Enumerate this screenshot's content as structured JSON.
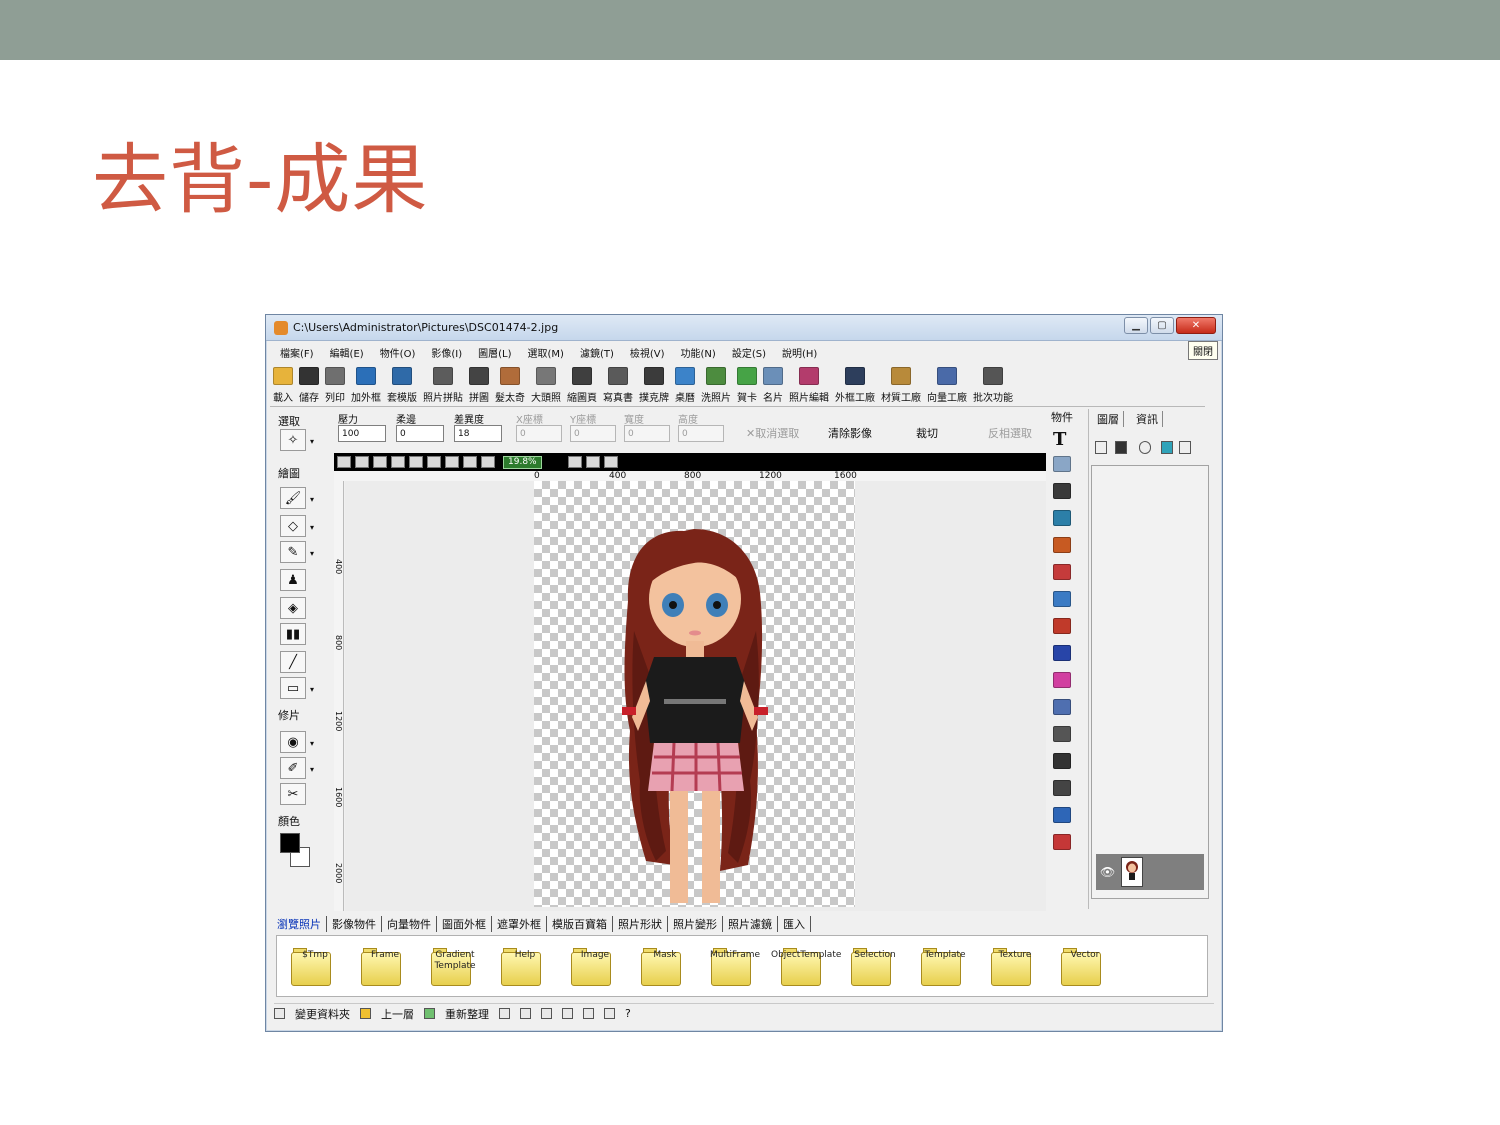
{
  "slide": {
    "title": "去背-成果",
    "colors": {
      "top_band": "#8f9e95",
      "title": "#cf5a43"
    }
  },
  "window": {
    "title": "C:\\Users\\Administrator\\Pictures\\DSC01474-2.jpg",
    "close_tooltip": "關閉",
    "buttons": {
      "minimize_icon": "minimize-icon",
      "maximize_icon": "maximize-icon",
      "close_icon": "close-icon"
    },
    "close_button_color": "#c62b19"
  },
  "menubar": [
    "檔案(F)",
    "編輯(E)",
    "物件(O)",
    "影像(I)",
    "圖層(L)",
    "選取(M)",
    "濾鏡(T)",
    "檢視(V)",
    "功能(N)",
    "設定(S)",
    "說明(H)"
  ],
  "toolbar": [
    {
      "label": "載入",
      "icon": "folder-open-icon",
      "color": "#e7b33b"
    },
    {
      "label": "儲存",
      "icon": "floppy-icon",
      "color": "#333333"
    },
    {
      "label": "列印",
      "icon": "printer-icon",
      "color": "#6f6f6f"
    },
    {
      "label": "加外框",
      "icon": "frame-icon",
      "color": "#2b6fb8"
    },
    {
      "label": "套模版",
      "icon": "template-icon",
      "color": "#2f6aa8"
    },
    {
      "label": "照片拼貼",
      "icon": "collage-icon",
      "color": "#5c5c5c"
    },
    {
      "label": "拼圖",
      "icon": "puzzle-icon",
      "color": "#444444"
    },
    {
      "label": "髮太奇",
      "icon": "hair-icon",
      "color": "#b06c3a"
    },
    {
      "label": "大頭照",
      "icon": "portrait-grid-icon",
      "color": "#777777"
    },
    {
      "label": "縮圖頁",
      "icon": "thumbnail-page-icon",
      "color": "#3f3f3f"
    },
    {
      "label": "寫真書",
      "icon": "photobook-icon",
      "color": "#5a5a5a"
    },
    {
      "label": "撲克牌",
      "icon": "poker-card-icon",
      "color": "#3b3b3b"
    },
    {
      "label": "桌曆",
      "icon": "desk-calendar-icon",
      "color": "#3c83c9"
    },
    {
      "label": "洗照片",
      "icon": "print-photo-icon",
      "color": "#4d8c3f"
    },
    {
      "label": "賀卡",
      "icon": "greeting-card-icon",
      "color": "#46a346"
    },
    {
      "label": "名片",
      "icon": "business-card-icon",
      "color": "#6b8fb8"
    },
    {
      "label": "照片編輯",
      "icon": "photo-edit-icon",
      "color": "#b33c6c"
    },
    {
      "label": "外框工廠",
      "icon": "frame-factory-icon",
      "color": "#2d3e5c"
    },
    {
      "label": "材質工廠",
      "icon": "texture-factory-icon",
      "color": "#b88a3a"
    },
    {
      "label": "向量工廠",
      "icon": "vector-factory-icon",
      "color": "#4a6aa8"
    },
    {
      "label": "批次功能",
      "icon": "batch-icon",
      "color": "#555555"
    }
  ],
  "left_panel": {
    "select_label": "選取",
    "draw_label": "繪圖",
    "retouch_label": "修片",
    "color_label": "顏色",
    "tools": [
      {
        "name": "magic-wand-icon",
        "glyph": "✧"
      },
      {
        "name": "brush-icon",
        "glyph": "🖌"
      },
      {
        "name": "eraser-icon",
        "glyph": "◇"
      },
      {
        "name": "pen-icon",
        "glyph": "✎"
      },
      {
        "name": "stamp-icon",
        "glyph": "♟"
      },
      {
        "name": "fill-bucket-icon",
        "glyph": "◈"
      },
      {
        "name": "gradient-icon",
        "glyph": "▮▮"
      },
      {
        "name": "eyedropper-icon",
        "glyph": "╱"
      },
      {
        "name": "rectangle-icon",
        "glyph": "▭"
      },
      {
        "name": "red-eye-icon",
        "glyph": "◉"
      },
      {
        "name": "heal-brush-icon",
        "glyph": "✐"
      },
      {
        "name": "clone-icon",
        "glyph": "✂"
      }
    ],
    "fg_color": "#000000",
    "bg_color": "#ffffff"
  },
  "options": {
    "pressure_label": "壓力",
    "softness_label": "柔邊",
    "tolerance_label": "差異度",
    "x_label": "X座標",
    "y_label": "Y座標",
    "width_label": "寬度",
    "height_label": "高度",
    "pressure_value": "100",
    "softness_value": "0",
    "tolerance_value": "18",
    "x_value": "0",
    "y_value": "0",
    "width_value": "0",
    "height_value": "0",
    "cancel_select": "✕取消選取",
    "clear_image": "清除影像",
    "crop": "裁切",
    "invert_select": "反相選取"
  },
  "canvas": {
    "zoom": "19.8%",
    "ruler_top": [
      "0",
      "400",
      "800",
      "1200",
      "1600"
    ],
    "ruler_left": [
      "400",
      "800",
      "1200",
      "1600",
      "2000"
    ]
  },
  "object_strip": {
    "label": "物件",
    "icons": [
      {
        "name": "text-icon",
        "color": "#000000"
      },
      {
        "name": "text-effect-icon",
        "color": "#8aa6c6"
      },
      {
        "name": "abc-stamp-icon",
        "color": "#3a3a3a"
      },
      {
        "name": "image-insert-icon",
        "color": "#2c7fa8"
      },
      {
        "name": "photo-insert-icon",
        "color": "#c75a22"
      },
      {
        "name": "layer-group-icon",
        "color": "#c53b3b"
      },
      {
        "name": "zoom-icon",
        "color": "#3b7bc4"
      },
      {
        "name": "clock-icon",
        "color": "#c03a2a"
      },
      {
        "name": "exif-icon",
        "color": "#2845a8"
      },
      {
        "name": "cake-icon",
        "color": "#d13fa0"
      },
      {
        "name": "calendar-icon",
        "color": "#4f6fb0"
      },
      {
        "name": "speech-bubble-icon",
        "color": "#555555"
      },
      {
        "name": "lines-icon",
        "color": "#333333"
      },
      {
        "name": "arrow-icon",
        "color": "#444444"
      },
      {
        "name": "star-shape-icon",
        "color": "#2e66b7"
      },
      {
        "name": "pattern-icon",
        "color": "#c53737"
      }
    ]
  },
  "layers_panel": {
    "tabs": [
      "圖層",
      "資訊"
    ],
    "icons": [
      "new-layer-icon",
      "delete-layer-icon",
      "lock-layer-icon",
      "layer-color-icon",
      "merge-layer-icon"
    ],
    "eye_icon": "eye-icon"
  },
  "bottom_tabs": [
    "瀏覽照片",
    "影像物件",
    "向量物件",
    "圖面外框",
    "遮罩外框",
    "模版百寶箱",
    "照片形狀",
    "照片變形",
    "照片濾鏡",
    "匯入"
  ],
  "folders": [
    {
      "name": "$Tmp"
    },
    {
      "name": "Frame"
    },
    {
      "name": "Gradient Template"
    },
    {
      "name": "Help"
    },
    {
      "name": "Image"
    },
    {
      "name": "Mask"
    },
    {
      "name": "MultiFrame"
    },
    {
      "name": "ObjectTemplate"
    },
    {
      "name": "Selection"
    },
    {
      "name": "Template"
    },
    {
      "name": "Texture"
    },
    {
      "name": "Vector"
    }
  ],
  "status": {
    "change_folder": "變更資料夾",
    "up_level": "上一層",
    "refresh": "重新整理",
    "help": "?"
  }
}
